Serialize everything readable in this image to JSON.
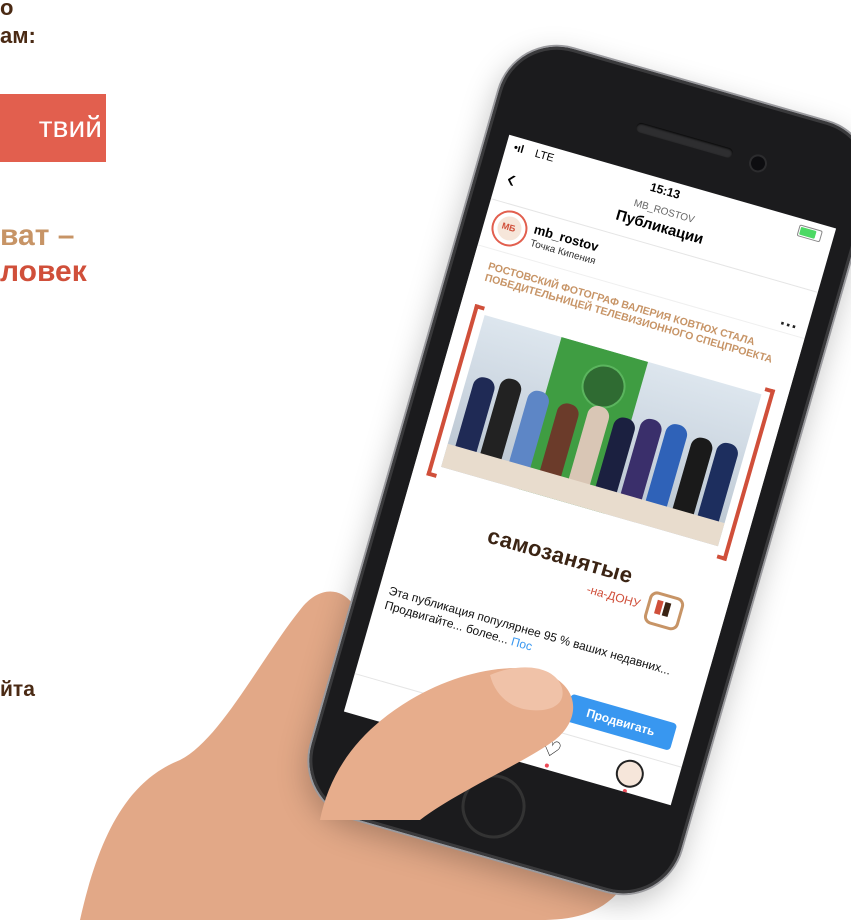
{
  "left_promo": {
    "top_line1": "о",
    "top_line2": "ам:",
    "banner": "твий",
    "heading_line1": "ват –",
    "heading_line2": "ловек",
    "bottom_text": "йта"
  },
  "phone": {
    "status": {
      "signal": "•ıl",
      "network": "LTE",
      "time": "15:13"
    },
    "nav": {
      "subtitle": "MB_ROSTOV",
      "title": "Публикации"
    },
    "post": {
      "username": "mb_rostov",
      "location": "Точка Кипения",
      "headline": "Ростовский фотограф Валерия Ковтюх стала победительницей телевизионного спецпроекта",
      "brand_main": "самозанятые",
      "brand_sub": "-на-ДОНУ"
    },
    "promo": {
      "text": "Эта публикация популярнее 95 % ваших недавних... Продвигайте... более...",
      "link": "Пос",
      "button": "Продвигать"
    }
  },
  "colors": {
    "banner": "#e25f4e",
    "tan": "#c79466",
    "brown": "#4a2a14",
    "instagram_blue": "#3897f0"
  },
  "icons": [
    "back-icon",
    "battery-icon",
    "more-icon",
    "add-icon",
    "heart-icon",
    "profile-icon"
  ]
}
